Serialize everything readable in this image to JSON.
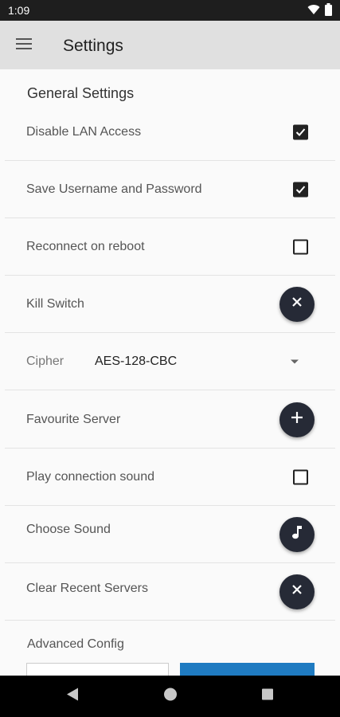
{
  "status_bar": {
    "time": "1:09",
    "icons": [
      "wifi-icon",
      "battery-icon"
    ]
  },
  "app_bar": {
    "title": "Settings",
    "menu_icon": "hamburger-menu-icon"
  },
  "general": {
    "title": "General Settings",
    "disable_lan": {
      "label": "Disable LAN Access",
      "checked": true
    },
    "save_credentials": {
      "label": "Save Username and Password",
      "checked": true
    },
    "reconnect_reboot": {
      "label": "Reconnect on reboot",
      "checked": false
    },
    "kill_switch": {
      "label": "Kill Switch",
      "icon": "close-icon"
    },
    "cipher": {
      "label": "Cipher",
      "value": "AES-128-CBC"
    },
    "favourite_server": {
      "label": "Favourite Server",
      "icon": "add-icon"
    },
    "connection_sound": {
      "label": "Play connection sound",
      "checked": false
    },
    "choose_sound": {
      "label": "Choose Sound",
      "icon": "music-note-icon"
    },
    "clear_recent": {
      "label": "Clear Recent Servers",
      "icon": "close-icon"
    }
  },
  "advanced": {
    "label": "Advanced Config"
  },
  "colors": {
    "fab": "#262a36",
    "accent_button": "#1f7bc1",
    "app_bar": "#e0e0e0"
  }
}
